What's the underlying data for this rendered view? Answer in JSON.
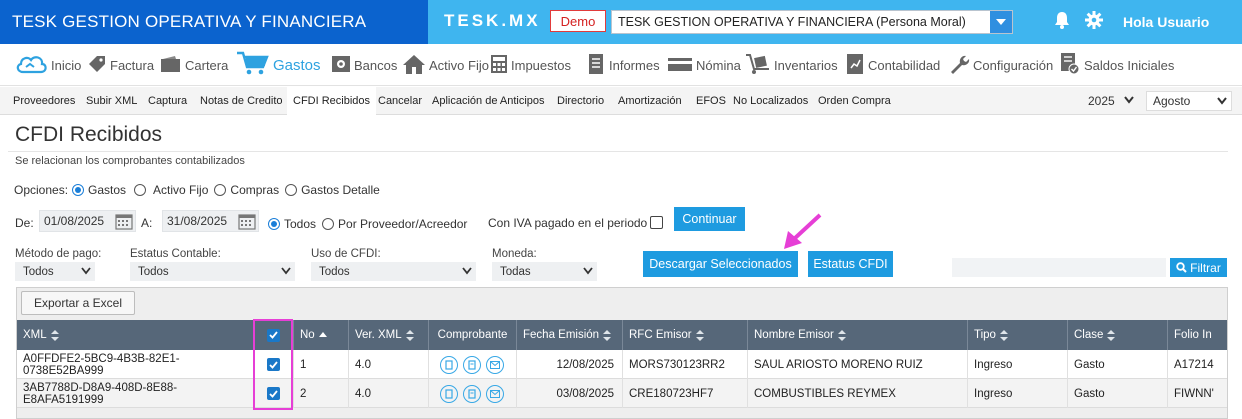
{
  "header": {
    "org_name": "TESK GESTION OPERATIVA Y FINANCIERA",
    "logo": "TESK.MX",
    "env_badge": "Demo",
    "company_selector": "TESK GESTION OPERATIVA Y FINANCIERA (Persona Moral)",
    "greeting": "Hola Usuario",
    "icons": [
      "bell-icon",
      "gear-icon"
    ]
  },
  "main_nav": [
    {
      "label": "Inicio",
      "icon": "cloud-icon"
    },
    {
      "label": "Factura",
      "icon": "tag-icon"
    },
    {
      "label": "Cartera",
      "icon": "wallet-icon"
    },
    {
      "label": "Gastos",
      "icon": "cart-icon",
      "active": true
    },
    {
      "label": "Bancos",
      "icon": "safe-icon"
    },
    {
      "label": "Activo Fijo",
      "icon": "house-icon"
    },
    {
      "label": "Impuestos",
      "icon": "calculator-icon"
    },
    {
      "label": "Informes",
      "icon": "document-icon"
    },
    {
      "label": "Nómina",
      "icon": "card-icon"
    },
    {
      "label": "Inventarios",
      "icon": "dolly-icon"
    },
    {
      "label": "Contabilidad",
      "icon": "ledger-icon"
    },
    {
      "label": "Configuración",
      "icon": "wrench-icon"
    },
    {
      "label": "Saldos Iniciales",
      "icon": "checklist-icon"
    }
  ],
  "sub_nav": [
    "Proveedores",
    "Subir XML",
    "Captura",
    "Notas de Credito",
    "CFDI Recibidos",
    "Cancelar",
    "Aplicación de Anticipos",
    "Directorio",
    "Amortización",
    "EFOS",
    "No Localizados",
    "Orden Compra"
  ],
  "period": {
    "year": "2025",
    "month": "Agosto"
  },
  "page": {
    "title": "CFDI Recibidos",
    "subtitle": "Se relacionan los comprobantes contabilizados"
  },
  "options": {
    "label": "Opciones:",
    "choices": [
      "Gastos",
      "Activo Fijo",
      "Compras",
      "Gastos Detalle"
    ],
    "selected": "Gastos"
  },
  "date_filter": {
    "from_label": "De:",
    "from": "01/08/2025",
    "to_label": "A:",
    "to": "31/08/2025",
    "scope_todos": "Todos",
    "scope_proveedor": "Por Proveedor/Acreedor",
    "iva_label": "Con IVA pagado en el periodo",
    "continue_label": "Continuar"
  },
  "filters": {
    "metodo_label": "Método de pago:",
    "metodo_value": "Todos",
    "estatus_label": "Estatus Contable:",
    "estatus_value": "Todos",
    "uso_label": "Uso de CFDI:",
    "uso_value": "Todos",
    "moneda_label": "Moneda:",
    "moneda_value": "Todas"
  },
  "actions": {
    "download_selected": "Descargar Seleccionados",
    "cfdi_status": "Estatus CFDI",
    "filter": "Filtrar",
    "export_excel": "Exportar a Excel"
  },
  "grid": {
    "columns": [
      "XML",
      "",
      "No",
      "Ver. XML",
      "Comprobante",
      "Fecha Emisión",
      "RFC Emisor",
      "Nombre Emisor",
      "Tipo",
      "Clase",
      "Folio In"
    ],
    "rows": [
      {
        "xml": "A0FFDFE2-5BC9-4B3B-82E1-0738E52BA999",
        "checked": true,
        "no": "1",
        "ver": "4.0",
        "fecha": "12/08/2025",
        "rfc": "MORS730123RR2",
        "nombre": "SAUL ARIOSTO MORENO RUIZ",
        "tipo": "Ingreso",
        "clase": "Gasto",
        "folio": "A17214"
      },
      {
        "xml": "3AB7788D-D8A9-408D-8E88-E8AFA5191999",
        "checked": true,
        "no": "2",
        "ver": "4.0",
        "fecha": "03/08/2025",
        "rfc": "CRE180723HF7",
        "nombre": "COMBUSTIBLES REYMEX",
        "tipo": "Ingreso",
        "clase": "Gasto",
        "folio": "FIWNN'"
      }
    ]
  },
  "colors": {
    "primary_blue": "#0b63ce",
    "sky_blue": "#3fb5ef",
    "button_blue": "#1e9be0",
    "header_gray": "#566779",
    "highlight_magenta": "#e63fd6"
  }
}
